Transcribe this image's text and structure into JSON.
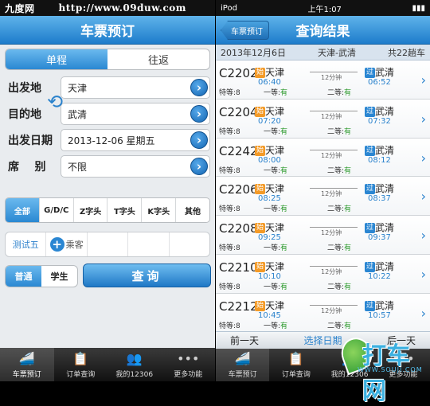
{
  "left": {
    "status": {
      "watermark": "http://www.09duw.com",
      "tag": "九度网"
    },
    "nav_title": "车票预订",
    "trip_tabs": [
      "单程",
      "往返"
    ],
    "form": {
      "from_label": "出发地",
      "from_value": "天津",
      "to_label": "目的地",
      "to_value": "武清",
      "date_label": "出发日期",
      "date_value": "2013-12-06 星期五",
      "seat_label": "席    别",
      "seat_value": "不限"
    },
    "train_types": [
      "全部",
      "G/D/C",
      "Z字头",
      "T字头",
      "K字头",
      "其他"
    ],
    "passengers": {
      "first": "测试五",
      "add": "乘客"
    },
    "passenger_types": [
      "普通",
      "学生"
    ],
    "query_label": "查询",
    "tabs": [
      "车票预订",
      "订单查询",
      "我的12306",
      "更多功能"
    ]
  },
  "right": {
    "status": {
      "device": "iPod",
      "time": "上午1:07"
    },
    "back_label": "车票预订",
    "nav_title": "查询结果",
    "summary": {
      "date": "2013年12月6日",
      "route": "天津-武清",
      "count": "共22趟车"
    },
    "trains": [
      {
        "no": "C2202",
        "from": "天津",
        "to": "武清",
        "dep": "06:40",
        "arr": "06:52",
        "dur": "12分钟",
        "c1": "8",
        "c2": "有",
        "c3": "有"
      },
      {
        "no": "C2204",
        "from": "天津",
        "to": "武清",
        "dep": "07:20",
        "arr": "07:32",
        "dur": "12分钟",
        "c1": "8",
        "c2": "有",
        "c3": "有"
      },
      {
        "no": "C2242",
        "from": "天津",
        "to": "武清",
        "dep": "08:00",
        "arr": "08:12",
        "dur": "12分钟",
        "c1": "8",
        "c2": "有",
        "c3": "有"
      },
      {
        "no": "C2206",
        "from": "天津",
        "to": "武清",
        "dep": "08:25",
        "arr": "08:37",
        "dur": "12分钟",
        "c1": "8",
        "c2": "有",
        "c3": "有"
      },
      {
        "no": "C2208",
        "from": "天津",
        "to": "武清",
        "dep": "09:25",
        "arr": "09:37",
        "dur": "12分钟",
        "c1": "8",
        "c2": "有",
        "c3": "有"
      },
      {
        "no": "C2210",
        "from": "天津",
        "to": "武清",
        "dep": "10:10",
        "arr": "10:22",
        "dur": "12分钟",
        "c1": "8",
        "c2": "有",
        "c3": "有"
      },
      {
        "no": "C2212",
        "from": "天津",
        "to": "武清",
        "dep": "10:45",
        "arr": "10:57",
        "dur": "12分钟",
        "c1": "8",
        "c2": "有",
        "c3": "有"
      }
    ],
    "seat_labels": {
      "a": "特等:",
      "b": "一等:",
      "c": "二等:"
    },
    "tag_start": "始",
    "tag_end": "过",
    "bottom": {
      "prev": "前一天",
      "mid": "选择日期",
      "next": "后一天"
    },
    "tabs": [
      "车票预订",
      "订单查询",
      "我的12306",
      "更多功能"
    ],
    "logo": {
      "text": "打车网",
      "sub": "WWW.SOUJI.COM"
    }
  }
}
